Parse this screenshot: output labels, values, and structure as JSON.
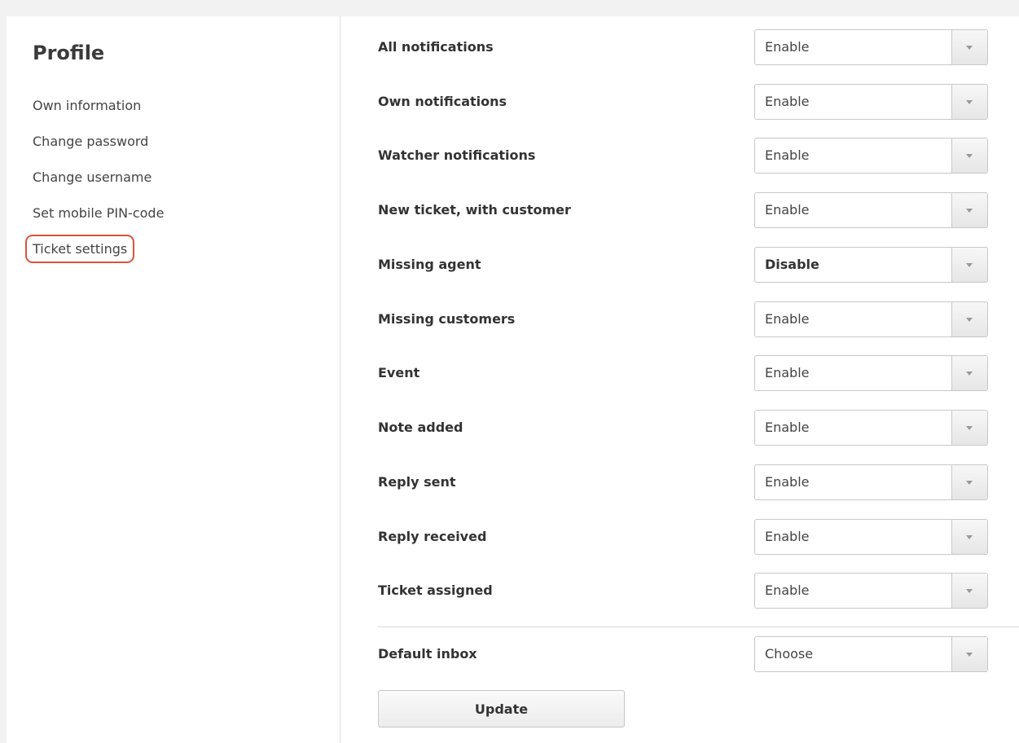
{
  "sidebar": {
    "title": "Profile",
    "items": [
      {
        "label": "Own information"
      },
      {
        "label": "Change password"
      },
      {
        "label": "Change username"
      },
      {
        "label": "Set mobile PIN-code"
      },
      {
        "label": "Ticket settings"
      }
    ],
    "highlight_color": "#d9533c"
  },
  "settings": [
    {
      "label": "All notifications",
      "value": "Enable"
    },
    {
      "label": "Own notifications",
      "value": "Enable"
    },
    {
      "label": "Watcher notifications",
      "value": "Enable"
    },
    {
      "label": "New ticket, with customer",
      "value": "Enable"
    },
    {
      "label": "Missing agent",
      "value": "Disable"
    },
    {
      "label": "Missing customers",
      "value": "Enable"
    },
    {
      "label": "Event",
      "value": "Enable"
    },
    {
      "label": "Note added",
      "value": "Enable"
    },
    {
      "label": "Reply sent",
      "value": "Enable"
    },
    {
      "label": "Reply received",
      "value": "Enable"
    },
    {
      "label": "Ticket assigned",
      "value": "Enable"
    }
  ],
  "default_inbox": {
    "label": "Default inbox",
    "value": "Choose"
  },
  "update_label": "Update"
}
